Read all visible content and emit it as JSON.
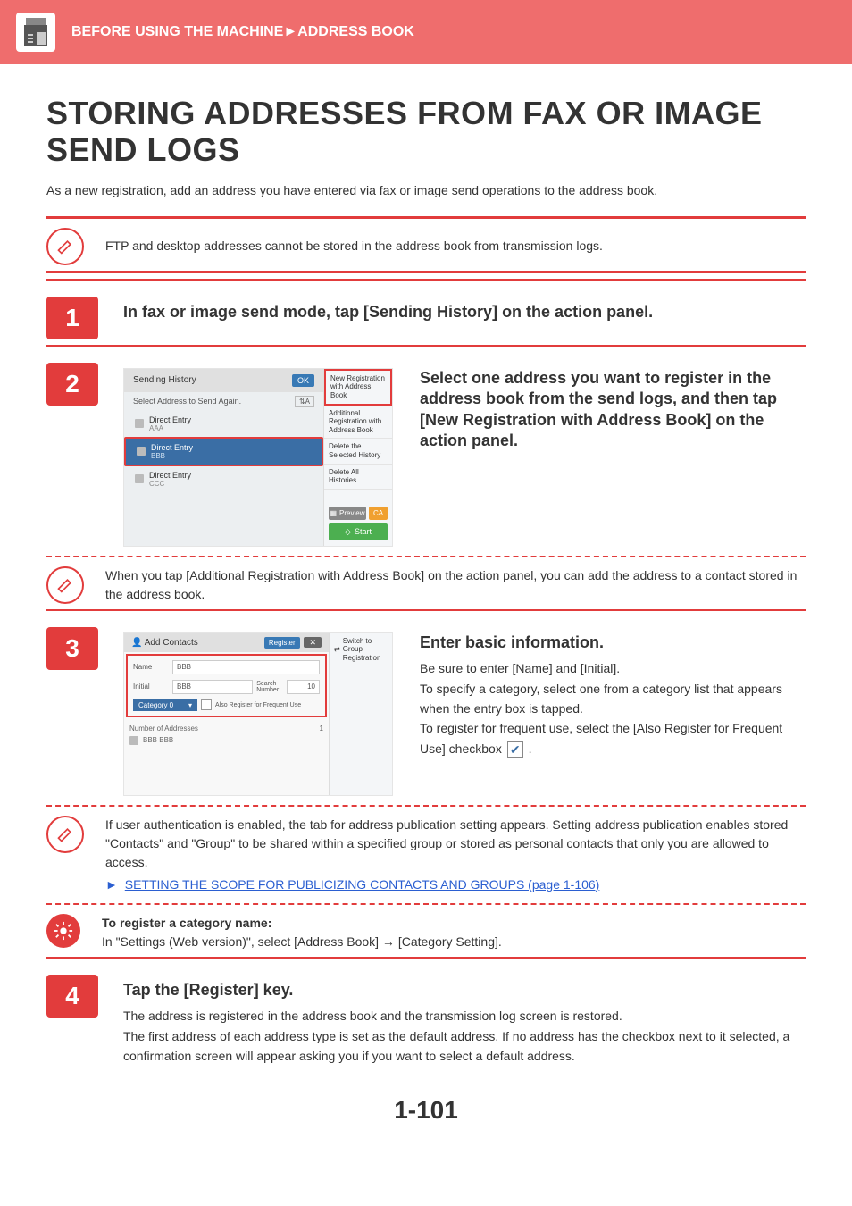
{
  "header": {
    "breadcrumb": "BEFORE USING THE MACHINE►ADDRESS BOOK"
  },
  "page_title": "STORING ADDRESSES FROM FAX OR IMAGE SEND LOGS",
  "intro": "As a new registration, add an address you have entered via fax or image send operations to the address book.",
  "top_note": "FTP and desktop addresses cannot be stored in the address book from transmission logs.",
  "step1": {
    "num": "1",
    "heading": "In fax or image send mode, tap [Sending History] on the action panel."
  },
  "step2": {
    "num": "2",
    "heading": "Select one address you want to register in the address book from the send logs, and then tap [New Registration with Address Book] on the action panel.",
    "shot": {
      "title": "Sending History",
      "ok": "OK",
      "subtitle": "Select Address to Send Again.",
      "entries": [
        {
          "label": "Direct Entry",
          "sub": "AAA"
        },
        {
          "label": "Direct Entry",
          "sub": "BBB"
        },
        {
          "label": "Direct Entry",
          "sub": "CCC"
        }
      ],
      "actions": {
        "new_reg": "New Registration with Address Book",
        "add_reg": "Additional Registration with Address Book",
        "del_sel": "Delete the Selected History",
        "del_all": "Delete All Histories"
      },
      "preview": "Preview",
      "ca": "CA",
      "start": "Start"
    },
    "tip": "When you tap [Additional Registration with Address Book] on the action panel, you can add the address to a contact stored in the address book."
  },
  "step3": {
    "num": "3",
    "heading": "Enter basic information.",
    "p1": "Be sure to enter [Name] and [Initial].",
    "p2": "To specify a category, select one from a category list that appears when the entry box is tapped.",
    "p3a": "To register for frequent use, select the [Also Register for Frequent Use] checkbox ",
    "p3b": ".",
    "shot": {
      "title": "Add Contacts",
      "register": "Register",
      "name_lbl": "Name",
      "name_val": "BBB",
      "initial_lbl": "Initial",
      "initial_val": "BBB",
      "search_lbl": "Search Number",
      "search_val": "10",
      "category_lbl": "Category 0",
      "also_reg": "Also Register for Frequent Use",
      "num_addr_lbl": "Number of Addresses",
      "num_addr_val": "1",
      "item1": "BBB BBB",
      "switch": "Switch to Group Registration"
    },
    "auth_note": "If user authentication is enabled, the tab for address publication setting appears. Setting address publication enables stored \"Contacts\" and \"Group\" to be shared within a specified group or stored as personal contacts that only you are allowed to access.",
    "link_text": "SETTING THE SCOPE FOR PUBLICIZING CONTACTS AND GROUPS (page 1-106)",
    "cat_heading": "To register a category name:",
    "cat_text": "In \"Settings (Web version)\", select [Address Book] → [Category Setting]."
  },
  "step4": {
    "num": "4",
    "heading": "Tap the [Register] key.",
    "p1": "The address is registered in the address book and the transmission log screen is restored.",
    "p2": "The first address of each address type is set as the default address. If no address has the checkbox next to it selected, a confirmation screen will appear asking you if you want to select a default address."
  },
  "page_number": "1-101"
}
